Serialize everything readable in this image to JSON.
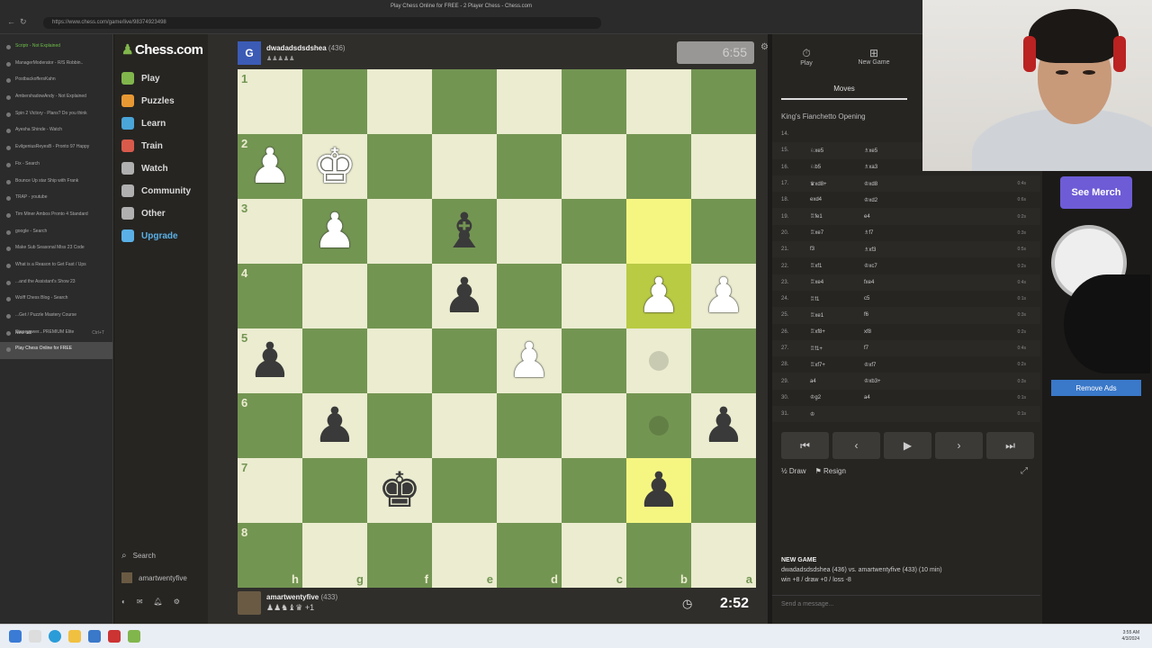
{
  "browser": {
    "window_title": "Play Chess Online for FREE - 2 Player Chess - Chess.com",
    "url": "https://www.chess.com/game/live/98374923498",
    "tabs": [
      "Scriptr - Not Explained",
      "ManagerModerator - R/S Robbin..",
      "PostbackoffersKahn",
      "AmbershadowAndy - Not Explained",
      "Spin 2 Victory - Plans? Do you think",
      "Ayesha Shinde - Watch",
      "EvilgeniusReyesB - Pronto 97 Happy",
      "Fix - Search",
      "Bounce Up star Ship with Frank",
      "TRAP - youtube",
      "Tim Miner Ambos Pronto 4 Standard",
      "google - Search",
      "Make Sub Seasonal Miss 23 Code",
      "What is a Reason to Get Fast / Ups",
      "...and the Assistant's Show 23",
      "Wolff Chess Blog - Search",
      "...Get / Puzzle Mastery Course",
      "Stonepower...PREMIUM Elite",
      "Play Chess Online for FREE"
    ],
    "new_tab_label": "New tab",
    "new_tab_meta": "Ctrl+T"
  },
  "chess_nav": {
    "logo": "Chess.com",
    "items": [
      {
        "label": "Play",
        "color": "#81b64c"
      },
      {
        "label": "Puzzles",
        "color": "#e89833"
      },
      {
        "label": "Learn",
        "color": "#4aa5d8"
      },
      {
        "label": "Train",
        "color": "#d85a4a"
      },
      {
        "label": "Watch",
        "color": "#b0b0b0"
      },
      {
        "label": "Community",
        "color": "#b0b0b0"
      },
      {
        "label": "Other",
        "color": "#b0b0b0"
      },
      {
        "label": "Upgrade",
        "color": "#5ab0e6"
      }
    ],
    "search_label": "Search",
    "username": "amartwentyfive"
  },
  "opponent": {
    "avatar_letter": "G",
    "name": "dwadadsdsdshea",
    "rating": "(436)",
    "captured": "♟♟♟♟♟"
  },
  "opponent_clock": "6:55",
  "me": {
    "name": "amartwentyfive",
    "rating": "(433)",
    "captured": "♟♟♞♝♛ +1"
  },
  "my_clock": "2:52",
  "board": {
    "ranks": [
      "1",
      "2",
      "3",
      "4",
      "5",
      "6",
      "7",
      "8"
    ],
    "files": [
      "h",
      "g",
      "f",
      "e",
      "d",
      "c",
      "b",
      "a"
    ],
    "pieces": [
      [
        "",
        "",
        "",
        "",
        "",
        "",
        "",
        ""
      ],
      [
        "wP",
        "wK",
        "",
        "",
        "",
        "",
        "",
        ""
      ],
      [
        "",
        "wP",
        "",
        "bB",
        "",
        "",
        "",
        ""
      ],
      [
        "",
        "",
        "",
        "bP",
        "",
        "",
        "wP",
        "wP"
      ],
      [
        "bP",
        "",
        "",
        "",
        "wP",
        "",
        "",
        ""
      ],
      [
        "",
        "bP",
        "",
        "",
        "",
        "",
        "",
        "bP"
      ],
      [
        "",
        "",
        "bK",
        "",
        "",
        "",
        "bP",
        ""
      ],
      [
        "",
        "",
        "",
        "",
        "",
        "",
        "",
        ""
      ]
    ],
    "highlight": [
      [
        2,
        6
      ],
      [
        3,
        6
      ],
      [
        6,
        6
      ]
    ],
    "hints": [
      [
        4,
        6
      ],
      [
        5,
        6
      ]
    ]
  },
  "panel": {
    "tabs": [
      "Play",
      "New Game"
    ],
    "moves_tab": "Moves",
    "opening": "King's Fianchetto Opening",
    "moves": [
      {
        "n": "14.",
        "w": "",
        "b": ""
      },
      {
        "n": "15.",
        "w": "♘xe5",
        "b": "♗xe5",
        "t": "0:1s"
      },
      {
        "n": "16.",
        "w": "♘b5",
        "b": "♗xa3",
        "t": "0:2s"
      },
      {
        "n": "17.",
        "w": "♛xd8+",
        "b": "♔xd8",
        "t": "0:4s"
      },
      {
        "n": "18.",
        "w": "exd4",
        "b": "♔xd2",
        "t": "0:6s"
      },
      {
        "n": "19.",
        "w": "♖fe1",
        "b": "e4",
        "t": "0:2s"
      },
      {
        "n": "20.",
        "w": "♖xe7",
        "b": "♗f7",
        "t": "0:3s"
      },
      {
        "n": "21.",
        "w": "f3",
        "b": "♗xf3",
        "t": "0:5s"
      },
      {
        "n": "22.",
        "w": "♖xf1",
        "b": "♔xc7",
        "t": "0:2s"
      },
      {
        "n": "23.",
        "w": "♖xe4",
        "b": "fxe4",
        "t": "0:4s"
      },
      {
        "n": "24.",
        "w": "♖f1",
        "b": "c5",
        "t": "0:1s"
      },
      {
        "n": "25.",
        "w": "♖xe1",
        "b": "f6",
        "t": "0:3s"
      },
      {
        "n": "26.",
        "w": "♖xf8+",
        "b": "xf8",
        "t": "0:2s"
      },
      {
        "n": "27.",
        "w": "♖f1+",
        "b": "f7",
        "t": "0:4s"
      },
      {
        "n": "28.",
        "w": "♖xf7+",
        "b": "♔xf7",
        "t": "0:2s"
      },
      {
        "n": "29.",
        "w": "a4",
        "b": "♔xb3+",
        "t": "0:3s"
      },
      {
        "n": "30.",
        "w": "♔g2",
        "b": "a4",
        "t": "0:1s"
      },
      {
        "n": "31.",
        "w": "♔",
        "b": "",
        "t": "0:1s"
      }
    ],
    "controls": [
      "⏮",
      "‹",
      "▶",
      "›",
      "⏭"
    ],
    "draw_label": "Draw",
    "resign_label": "Resign",
    "new_game_title": "NEW GAME",
    "new_game_line1": "dwadadsdsdshea (436) vs. amartwentyfive (433) (10 min)",
    "new_game_line2": "win +8 / draw +0 / loss -8",
    "chat_placeholder": "Send a message..."
  },
  "ad": {
    "merch_label": "See Merch",
    "remove_ads_label": "Remove Ads"
  },
  "taskbar": {
    "time": "3:55 AM",
    "date": "4/3/2024"
  }
}
